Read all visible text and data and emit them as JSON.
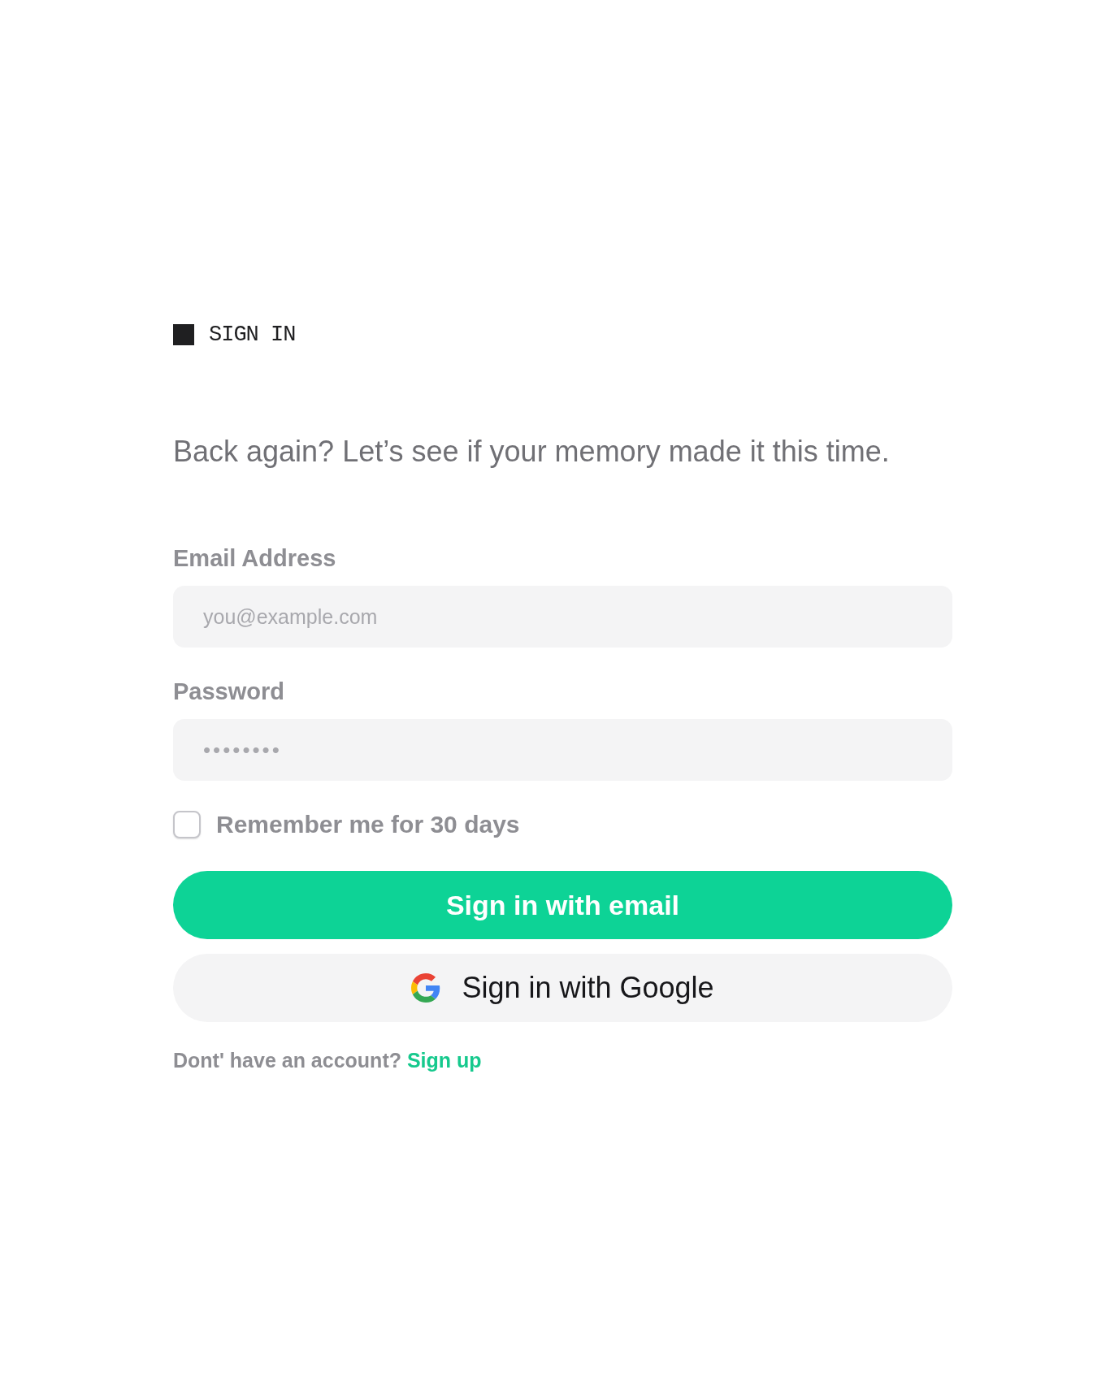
{
  "header": {
    "title": "SIGN IN"
  },
  "subtitle": "Back again? Let’s see if your memory made it this time.",
  "fields": [
    {
      "kind": "email",
      "label": "Email Address",
      "placeholder": "you@example.com"
    },
    {
      "kind": "password",
      "label": "Password",
      "placeholder": "••••••••"
    }
  ],
  "remember": {
    "label": "Remember me for 30 days",
    "checked": false
  },
  "buttons": [
    {
      "kind": "primary",
      "label": "Sign in with email"
    },
    {
      "kind": "google",
      "label": "Sign in with Google"
    }
  ],
  "footer": {
    "text": "Dont' have an account?",
    "link": "Sign up"
  }
}
